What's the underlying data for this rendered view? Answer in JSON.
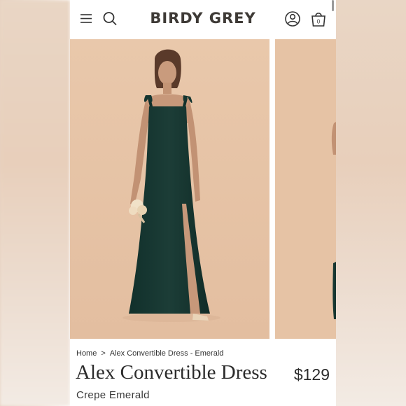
{
  "header": {
    "brand": "BIRDY GREY",
    "cart_count": "0"
  },
  "breadcrumb": {
    "home": "Home",
    "separator": ">",
    "current": "Alex Convertible Dress - Emerald"
  },
  "product": {
    "name": "Alex Convertible Dress",
    "price": "$129",
    "fabric_color": "Crepe Emerald"
  },
  "colors": {
    "photo_background": "#e7c4a6",
    "dress": "#173731",
    "text": "#2b2b2b"
  },
  "icons": [
    "menu-icon",
    "search-icon",
    "account-icon",
    "bag-icon"
  ]
}
